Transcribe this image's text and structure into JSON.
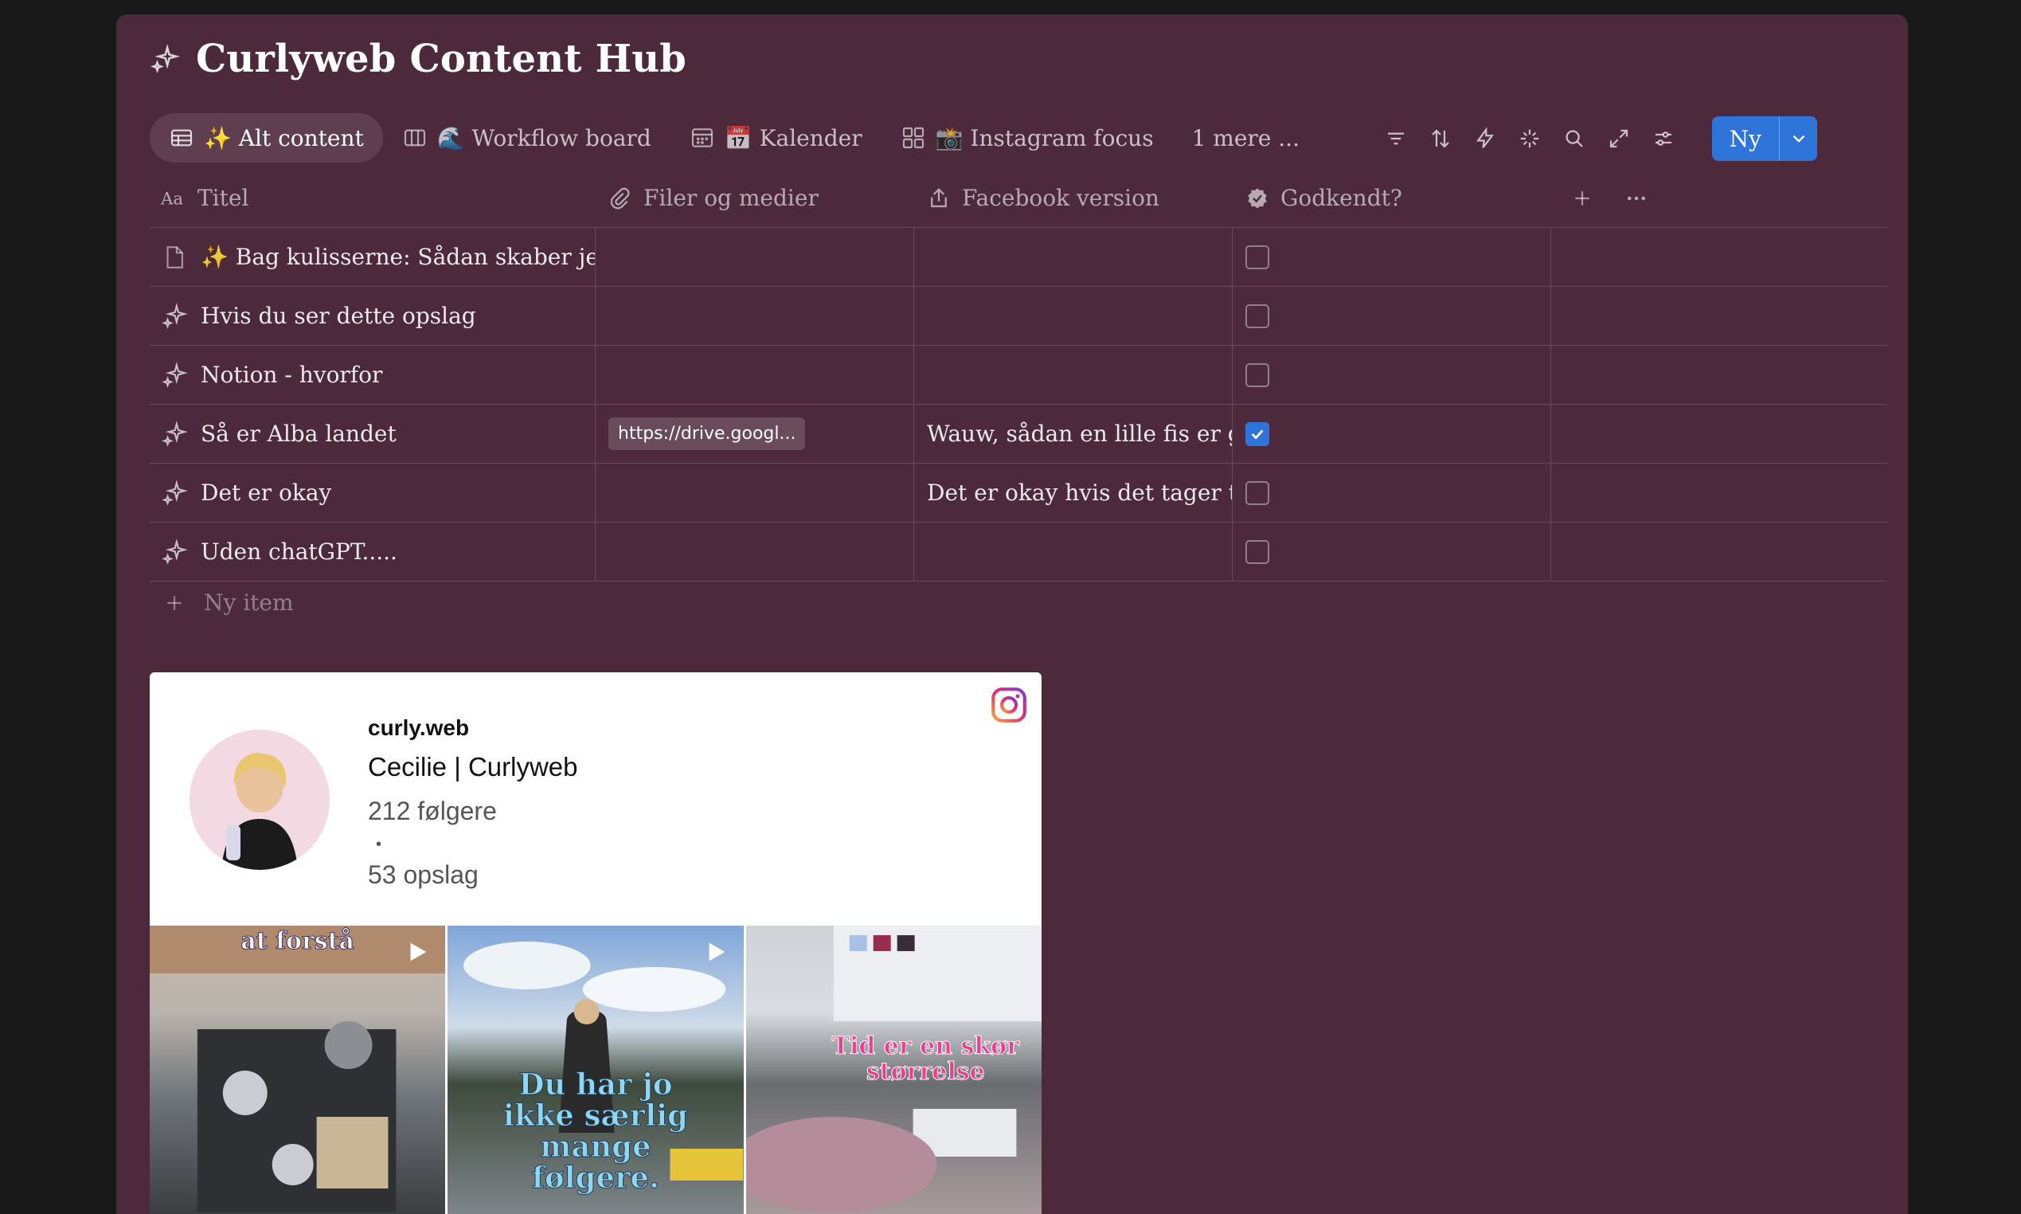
{
  "page": {
    "title": "Curlyweb Content Hub"
  },
  "tabs": [
    {
      "label": "✨ Alt content",
      "icon": "table-icon",
      "active": true
    },
    {
      "label": "🌊 Workflow board",
      "icon": "board-icon"
    },
    {
      "label": "📅 Kalender",
      "icon": "calendar-icon"
    },
    {
      "label": "📸 Instagram focus",
      "icon": "gallery-icon"
    }
  ],
  "more_label": "1 mere ...",
  "toolbar": {
    "new_label": "Ny"
  },
  "columns": {
    "title": "Titel",
    "files": "Filer og medier",
    "facebook": "Facebook version",
    "approved": "Godkendt?"
  },
  "rows": [
    {
      "title": "✨ Bag kulisserne: Sådan skaber jeg keramik",
      "file": "",
      "facebook": "",
      "approved": false
    },
    {
      "title": "Hvis du ser dette opslag",
      "file": "",
      "facebook": "",
      "approved": false
    },
    {
      "title": "Notion - hvorfor",
      "file": "",
      "facebook": "",
      "approved": false
    },
    {
      "title": "Så er Alba landet",
      "file": "https://drive.googl...",
      "facebook": "Wauw, sådan en lille fis er godt",
      "approved": true
    },
    {
      "title": "Det er okay",
      "file": "",
      "facebook": "Det er okay hvis det tager tid at",
      "approved": false
    },
    {
      "title": "Uden chatGPT.....",
      "file": "",
      "facebook": "",
      "approved": false
    }
  ],
  "new_item_label": "Ny item",
  "instagram": {
    "handle": "curly.web",
    "name": "Cecilie | Curlyweb",
    "followers": "212 følgere",
    "dot": "•",
    "posts": "53 opslag",
    "tiles": [
      {
        "text": "at forstå"
      },
      {
        "text": "Du har jo ikke særlig mange følgere."
      },
      {
        "text": "Tid er en skør størrelse"
      }
    ]
  },
  "colors": {
    "background": "#4c2a3b",
    "accent": "#2f74d8"
  }
}
